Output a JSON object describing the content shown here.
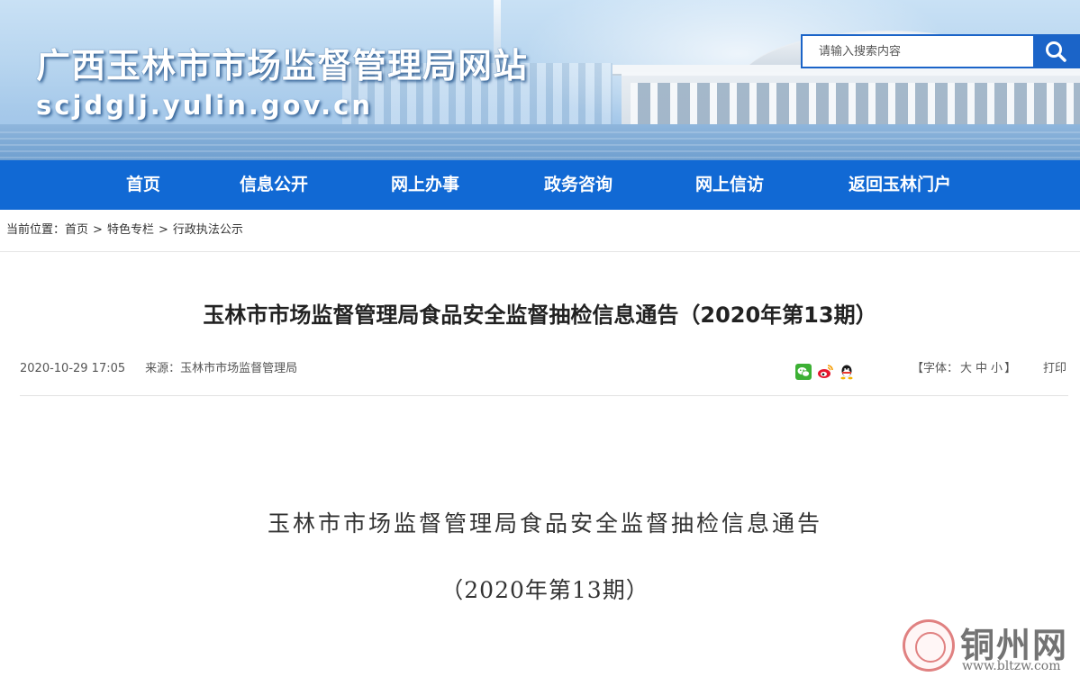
{
  "header": {
    "site_title": "广西玉林市市场监督管理局网站",
    "site_domain": "scjdglj.yulin.gov.cn"
  },
  "search": {
    "placeholder": "请输入搜索内容",
    "button_icon": "search-icon"
  },
  "nav": {
    "items": [
      {
        "label": "首页"
      },
      {
        "label": "信息公开"
      },
      {
        "label": "网上办事"
      },
      {
        "label": "政务咨询"
      },
      {
        "label": "网上信访"
      },
      {
        "label": "返回玉林门户"
      }
    ]
  },
  "breadcrumb": {
    "prefix": "当前位置：",
    "items": [
      {
        "label": "首页"
      },
      {
        "label": "特色专栏"
      },
      {
        "label": "行政执法公示"
      }
    ],
    "separator": ">"
  },
  "article": {
    "title": "玉林市市场监督管理局食品安全监督抽检信息通告（2020年第13期）",
    "date": "2020-10-29 17:05",
    "source": "来源：玉林市市场监督管理局",
    "share_icons": [
      "wechat-icon",
      "weibo-icon",
      "qq-icon"
    ],
    "font_size": {
      "open": "【字体：",
      "large": "大",
      "medium": "中",
      "small": "小",
      "close": "】"
    },
    "print_label": "打印",
    "body_heading_1": "玉林市市场监督管理局食品安全监督抽检信息通告",
    "body_heading_2": "（2020年第13期）"
  },
  "watermark": {
    "name": "铜州网",
    "url": "www.bltzw.com"
  },
  "colors": {
    "nav_bg": "#1169d4",
    "search_border": "#1b64c8",
    "seal_red": "#d65a5a"
  }
}
